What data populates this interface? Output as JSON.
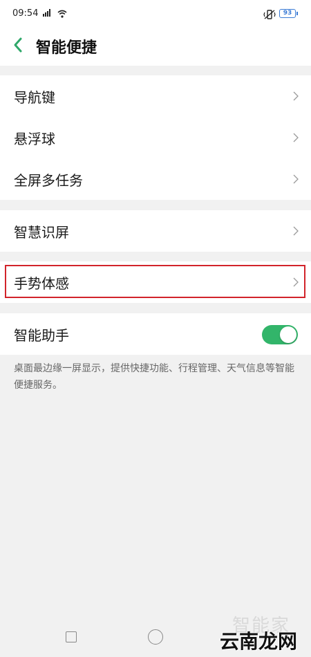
{
  "status_bar": {
    "time": "09:54",
    "signal": "░ıl",
    "battery": "93",
    "accent": "#3a7bd5"
  },
  "header": {
    "title": "智能便捷",
    "back_icon": "chevron-left-icon",
    "accent": "#2fa86a"
  },
  "groups": [
    {
      "items": [
        {
          "label": "导航键"
        },
        {
          "label": "悬浮球"
        },
        {
          "label": "全屏多任务"
        }
      ]
    },
    {
      "items": [
        {
          "label": "智慧识屏"
        }
      ]
    },
    {
      "items": [
        {
          "label": "手势体感",
          "highlighted": true
        }
      ]
    },
    {
      "items": [
        {
          "label": "智能助手",
          "toggle": true,
          "toggle_on": true
        }
      ]
    }
  ],
  "description": "桌面最边缘一屏显示，提供快捷功能、行程管理、天气信息等智能便捷服务。",
  "toggle_color": "#32b56a",
  "highlight_color": "#d2232a",
  "watermark": {
    "top": "智能家",
    "main": "云南龙网"
  },
  "nav_bar": {
    "recent_icon": "square-icon",
    "home_icon": "circle-icon"
  }
}
